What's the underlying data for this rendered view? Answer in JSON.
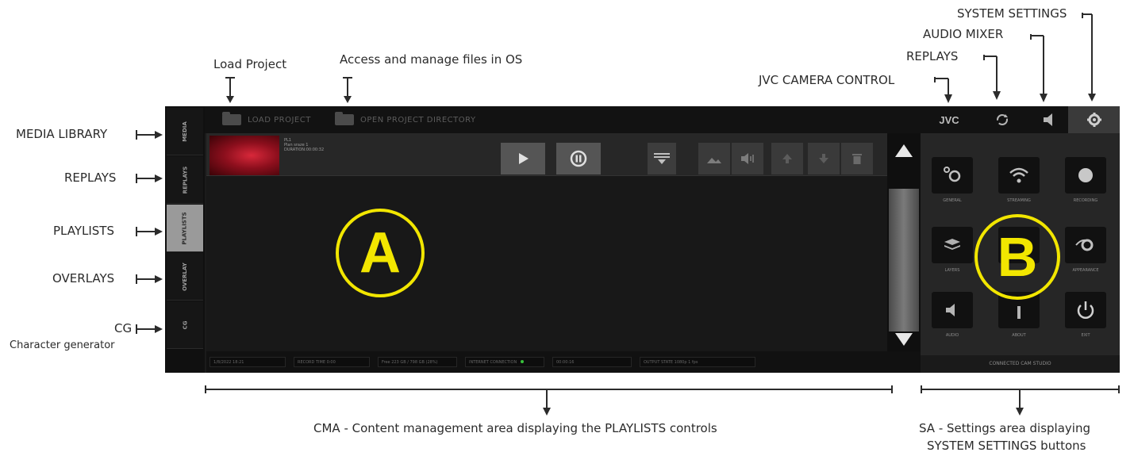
{
  "annotations": {
    "load_project": "Load Project",
    "access_files": "Access and manage files in OS",
    "system_settings": "SYSTEM SETTINGS",
    "audio_mixer": "AUDIO MIXER",
    "replays_top": "REPLAYS",
    "jvc_camera_control": "JVC CAMERA CONTROL",
    "media_library": "MEDIA LIBRARY",
    "replays_left": "REPLAYS",
    "playlists": "PLAYLISTS",
    "overlays": "OVERLAYS",
    "cg": "CG",
    "cg_sub": "Character generator",
    "cma_caption": "CMA - Content management area displaying the PLAYLISTS controls",
    "sa_caption_1": "SA - Settings area displaying",
    "sa_caption_2": "SYSTEM SETTINGS buttons",
    "circle_a": "A",
    "circle_b": "B"
  },
  "topbar": {
    "load_project": "LOAD PROJECT",
    "open_project_directory": "OPEN PROJECT DIRECTORY",
    "jvc": "JVC"
  },
  "leftnav": {
    "tabs": [
      "MEDIA",
      "REPLAYS",
      "PLAYLISTS",
      "OVERLAY",
      "CG"
    ],
    "active": "PLAYLISTS"
  },
  "clip": {
    "line1": "PL1",
    "line2": "Plan sraze 1",
    "line3": "DURATION:00:00:32"
  },
  "statusbar": {
    "cells": [
      "1/8/2022 18:21",
      "RECORD TIME 0:00",
      "Free 223 GB / 798 GB (28%)",
      "INTERNET CONNECTION",
      "00:00:16",
      "OUTPUT STATE 1080p 1 fps"
    ]
  },
  "settings": {
    "buttons": [
      "GENERAL",
      "STREAMING",
      "RECORDING",
      "LAYERS",
      "",
      "APPEARANCE",
      "AUDIO",
      "ABOUT",
      "EXIT"
    ],
    "footer": "CONNECTED CAM STUDIO"
  },
  "colors": {
    "accent_yellow": "#f2e600",
    "app_bg": "#1b1b1b",
    "status_green": "#39c13c"
  }
}
